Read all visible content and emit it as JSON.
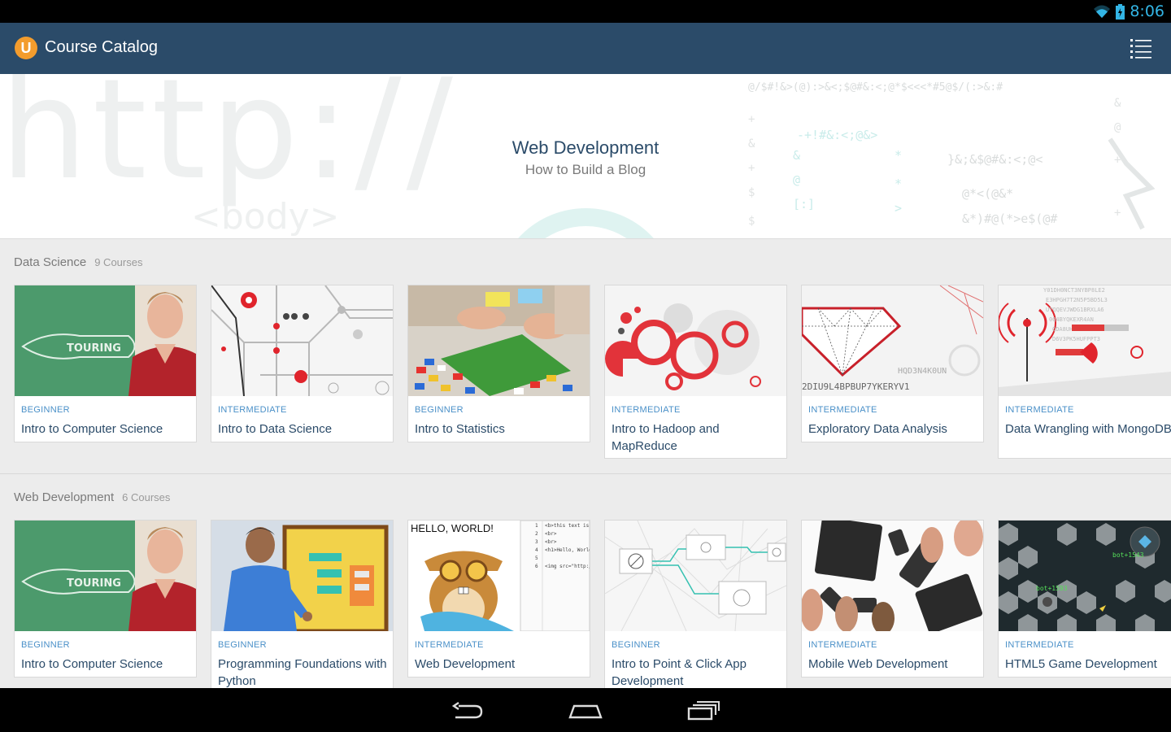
{
  "status_bar": {
    "time": "8:06"
  },
  "action_bar": {
    "logo_letter": "U",
    "title": "Course Catalog"
  },
  "hero": {
    "title": "Web Development",
    "subtitle": "How to Build a Blog",
    "bg_text_1": "http://",
    "bg_text_2": "<body>"
  },
  "sections": [
    {
      "title": "Data Science",
      "count": "9 Courses",
      "courses": [
        {
          "level": "BEGINNER",
          "name": "Intro to Computer Science",
          "thumb": "chalkboard-instructor"
        },
        {
          "level": "INTERMEDIATE",
          "name": "Intro to Data Science",
          "thumb": "subway-map"
        },
        {
          "level": "BEGINNER",
          "name": "Intro to Statistics",
          "thumb": "lego-bricks"
        },
        {
          "level": "INTERMEDIATE",
          "name": "Intro to Hadoop and MapReduce",
          "thumb": "red-circles"
        },
        {
          "level": "INTERMEDIATE",
          "name": "Exploratory Data Analysis",
          "thumb": "wireframe-gem"
        },
        {
          "level": "INTERMEDIATE",
          "name": "Data Wrangling with MongoDB",
          "thumb": "radio-tower"
        }
      ]
    },
    {
      "title": "Web Development",
      "count": "6 Courses",
      "courses": [
        {
          "level": "BEGINNER",
          "name": "Intro to Computer Science",
          "thumb": "chalkboard-instructor"
        },
        {
          "level": "BEGINNER",
          "name": "Programming Foundations with Python",
          "thumb": "python-instructor"
        },
        {
          "level": "INTERMEDIATE",
          "name": "Web Development",
          "thumb": "hello-world-squirrel",
          "thumb_text": "HELLO, WORLD!"
        },
        {
          "level": "BEGINNER",
          "name": "Intro to Point & Click App Development",
          "thumb": "network-diagram"
        },
        {
          "level": "INTERMEDIATE",
          "name": "Mobile Web Development",
          "thumb": "phones-hands"
        },
        {
          "level": "INTERMEDIATE",
          "name": "HTML5 Game Development",
          "thumb": "hex-game"
        }
      ]
    }
  ],
  "colors": {
    "action_bar": "#2b4b69",
    "accent_orange": "#f39c2d",
    "level_text": "#4a90c8",
    "status_accent": "#33b5e5"
  }
}
